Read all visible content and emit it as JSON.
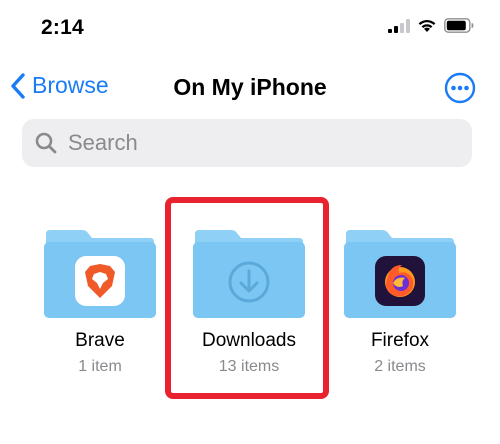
{
  "status_bar": {
    "time": "2:14",
    "icons": [
      "cellular-signal-icon",
      "wifi-icon",
      "battery-icon"
    ]
  },
  "nav": {
    "back_label": "Browse",
    "title": "On My iPhone",
    "more_icon": "more-ellipsis-icon"
  },
  "search": {
    "placeholder": "Search",
    "value": ""
  },
  "folders": [
    {
      "name": "Brave",
      "count": "1 item",
      "icon": "brave-app-icon"
    },
    {
      "name": "Downloads",
      "count": "13 items",
      "icon": "download-arrow-icon",
      "highlighted": true
    },
    {
      "name": "Firefox",
      "count": "2 items",
      "icon": "firefox-app-icon"
    }
  ],
  "colors": {
    "accent": "#1a7cf5",
    "folder": "#7cc6f3",
    "folder_back": "#8fd0f6",
    "highlight": "#e8232f",
    "search_bg": "#eeeef0",
    "secondary_text": "#8a8a8e"
  }
}
